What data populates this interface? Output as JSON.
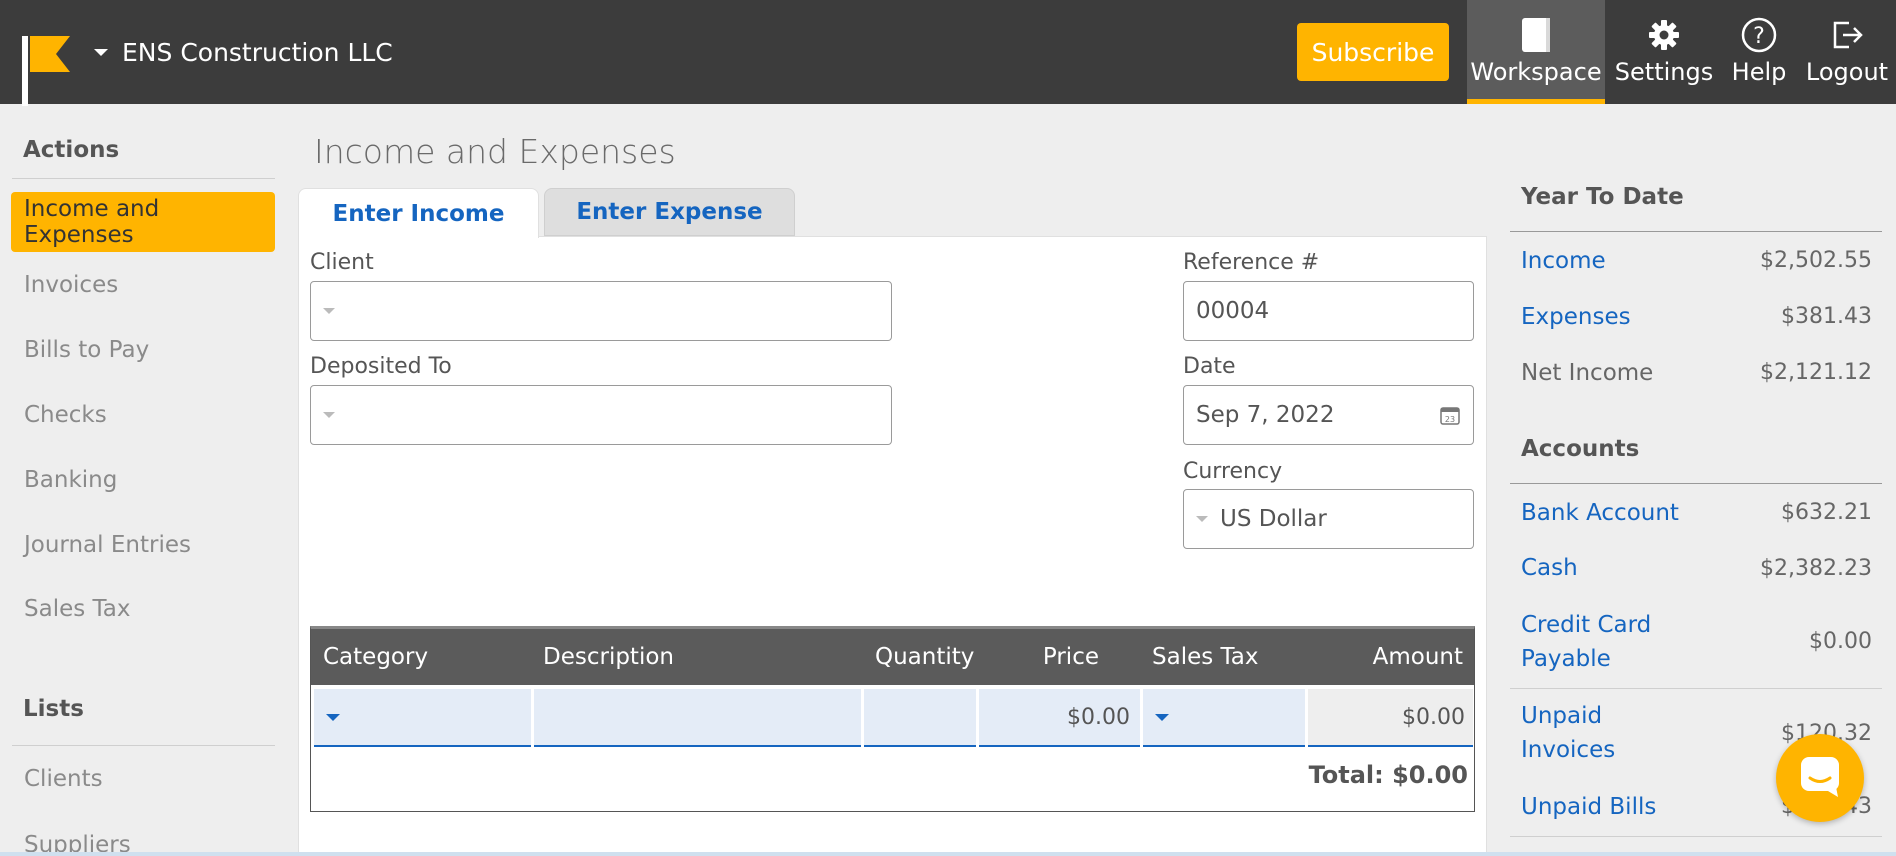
{
  "header": {
    "company_name": "ENS Construction LLC",
    "subscribe_label": "Subscribe",
    "nav": [
      {
        "label": "Workspace",
        "icon": "notebook-icon",
        "active": true
      },
      {
        "label": "Settings",
        "icon": "gear-icon"
      },
      {
        "label": "Help",
        "icon": "question-circle-icon"
      },
      {
        "label": "Logout",
        "icon": "logout-icon"
      }
    ],
    "accent_color": "#ffb400"
  },
  "sidebar": {
    "actions_heading": "Actions",
    "actions": [
      {
        "label": "Income and Expenses",
        "active": true
      },
      {
        "label": "Invoices"
      },
      {
        "label": "Bills to Pay"
      },
      {
        "label": "Checks"
      },
      {
        "label": "Banking"
      },
      {
        "label": "Journal Entries"
      },
      {
        "label": "Sales Tax"
      }
    ],
    "lists_heading": "Lists",
    "lists": [
      {
        "label": "Clients"
      },
      {
        "label": "Suppliers"
      }
    ]
  },
  "main": {
    "title": "Income and Expenses",
    "tabs": [
      {
        "label": "Enter Income",
        "active": true
      },
      {
        "label": "Enter Expense"
      }
    ],
    "form": {
      "client_label": "Client",
      "client_value": "",
      "deposited_label": "Deposited To",
      "deposited_value": "",
      "reference_label": "Reference #",
      "reference_value": "00004",
      "date_label": "Date",
      "date_value": "Sep 7, 2022",
      "currency_label": "Currency",
      "currency_value": "US Dollar"
    },
    "table": {
      "columns": [
        "Category",
        "Description",
        "Quantity",
        "Price",
        "Sales Tax",
        "Amount"
      ],
      "row": {
        "category": "",
        "description": "",
        "quantity": "",
        "price": "$0.00",
        "sales_tax": "",
        "amount": "$0.00"
      },
      "total": "Total: $0.00"
    }
  },
  "right_panel": {
    "ytd_heading": "Year To Date",
    "ytd": [
      {
        "label": "Income",
        "value": "$2,502.55",
        "link": true
      },
      {
        "label": "Expenses",
        "value": "$381.43",
        "link": true
      },
      {
        "label": "Net Income",
        "value": "$2,121.12",
        "link": false
      }
    ],
    "accounts_heading": "Accounts",
    "accounts": [
      {
        "label": "Bank Account",
        "value": "$632.21"
      },
      {
        "label": "Cash",
        "value": "$2,382.23"
      },
      {
        "label": "Credit Card Payable",
        "value": "$0.00"
      },
      {
        "label": "Unpaid Invoices",
        "value": "$120.32"
      },
      {
        "label": "Unpaid Bills",
        "value": "$381.43"
      }
    ]
  }
}
